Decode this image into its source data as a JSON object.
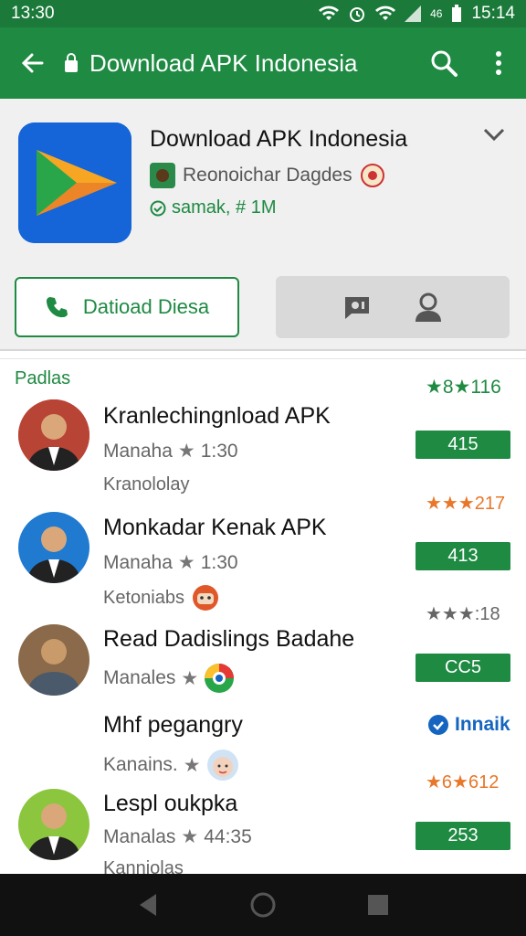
{
  "status_bar": {
    "time": "13:30",
    "time_right": "15:14",
    "signal_text": "46"
  },
  "app_bar": {
    "title": "Download APK Indonesia"
  },
  "app": {
    "title": "Download APK Indonesia",
    "developer": "Reonoichar Dagdes",
    "meta": "samak, # 1M"
  },
  "buttons": {
    "primary_label": "Datioad Diesa"
  },
  "list": {
    "section_label": "Padlas",
    "section_rating": "★8★116",
    "items": [
      {
        "name": "Kranlechingnload APK",
        "sub": "Manaha",
        "time": "1:30",
        "third": "Kranololay",
        "badge": "415",
        "rating": "★★★217"
      },
      {
        "name": "Monkadar Kenak APK",
        "sub": "Manaha",
        "time": "1:30",
        "third": "Ketoniabs",
        "badge": "413",
        "rating": "★★★:18"
      },
      {
        "name": "Read Dadislings Badahe",
        "sub": "Manales",
        "time": "",
        "third": "",
        "badge": "CC5",
        "rating": ""
      },
      {
        "name": "Mhf pegangry",
        "sub": "Kanains.",
        "time": "",
        "third": "",
        "badge": "Innaik",
        "rating": "★6★612"
      },
      {
        "name": "Lespl oukpka",
        "sub": "Manalas",
        "time": "44:35",
        "third": "Kannjolas",
        "badge": "253",
        "rating": ""
      }
    ]
  },
  "colors": {
    "primary": "#1e8a42",
    "status": "#1b7a3a",
    "rating_orange": "#e8772a",
    "blue_badge": "#1565c0"
  }
}
